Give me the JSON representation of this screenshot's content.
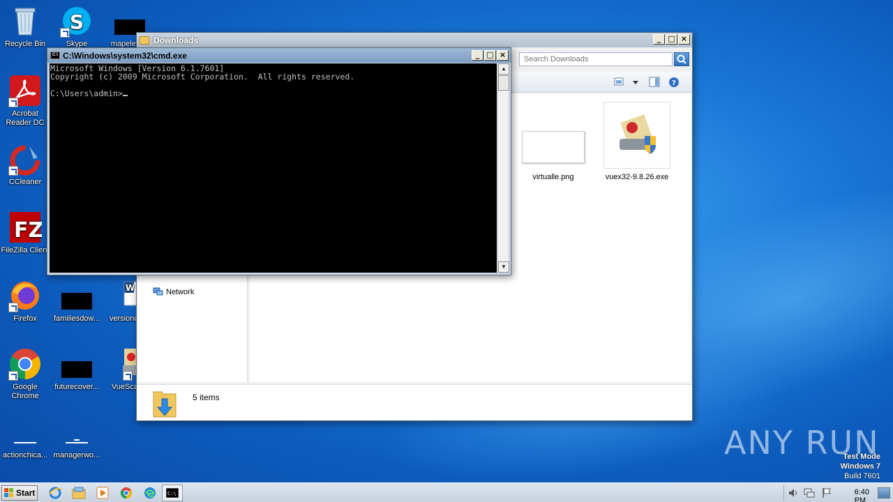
{
  "desktop": {
    "icons": [
      {
        "label": "Recycle Bin"
      },
      {
        "label": "Skype"
      },
      {
        "label": "mapelem..."
      },
      {
        "label": "Acrobat Reader DC"
      },
      {
        "label": "CCleaner"
      },
      {
        "label": "FileZilla Client"
      },
      {
        "label": "Firefox"
      },
      {
        "label": "familiesdow..."
      },
      {
        "label": "versionc..."
      },
      {
        "label": "Google Chrome"
      },
      {
        "label": "futurecover..."
      },
      {
        "label": "VueScan"
      },
      {
        "label": "actionchica..."
      },
      {
        "label": "managerwo..."
      }
    ]
  },
  "explorer": {
    "title": "Downloads",
    "search_placeholder": "Search Downloads",
    "nav_network": "Network",
    "files": [
      {
        "name": "virtualle.png"
      },
      {
        "name": "vuex32-9.8.26.exe"
      }
    ],
    "status": "5 items"
  },
  "cmd": {
    "title": "C:\\Windows\\system32\\cmd.exe",
    "lines": [
      "Microsoft Windows [Version 6.1.7601]",
      "Copyright (c) 2009 Microsoft Corporation.  All rights reserved.",
      "",
      "C:\\Users\\admin>"
    ]
  },
  "taskbar": {
    "start_label": "Start",
    "clock": "6:40 PM"
  },
  "watermark": {
    "line1": "Test Mode",
    "line2": "Windows 7",
    "line3": "Build 7601",
    "brand": "ANY RUN"
  },
  "colors": {
    "desktop_blue": "#1a78d8",
    "cmd_bg": "#000000",
    "cmd_fg": "#c0c0c0"
  }
}
